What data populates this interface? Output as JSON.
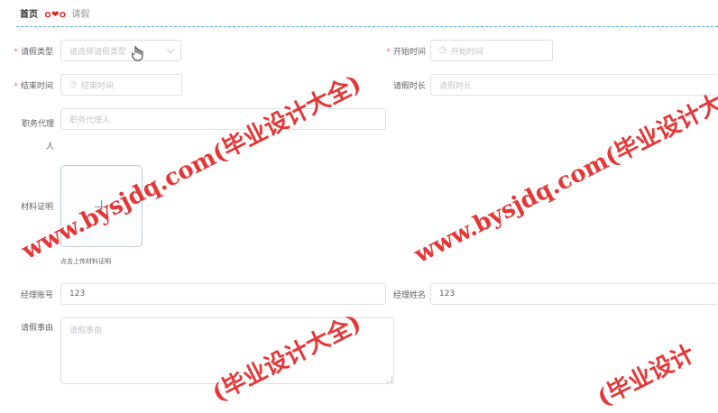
{
  "breadcrumb": {
    "home": "首页",
    "separator_glyphs": "ｏ❤ｏ",
    "current": "请假"
  },
  "form": {
    "leave_type": {
      "label": "请假类型",
      "placeholder": "请选择请假类型",
      "required": true
    },
    "start_time": {
      "label": "开始时间",
      "placeholder": "开始时间",
      "required": true
    },
    "end_time": {
      "label": "结束时间",
      "placeholder": "结束时间",
      "required": true
    },
    "duration": {
      "label": "请假时长",
      "placeholder": "请假时长"
    },
    "deputy": {
      "label": "职务代理人",
      "placeholder": "职务代理人"
    },
    "material": {
      "label": "材料证明",
      "plus": "+",
      "hint": "点击上传材料证明"
    },
    "manager_account": {
      "label": "经理账号",
      "value": "123"
    },
    "manager_name": {
      "label": "经理姓名",
      "value": "123"
    },
    "reason": {
      "label": "请假事由",
      "placeholder": "请假事由"
    }
  },
  "watermark": {
    "site": "www.bysjdq.com(毕业设计大全)",
    "domain": "www.bysjdq.com(毕业设计大全)",
    "suffix": "(毕业设计大全)",
    "prefix": "(毕业设计"
  },
  "colors": {
    "required": "#f56c6c",
    "watermark": "#e01414",
    "dashed_line": "#5fb0e6",
    "border": "#dcdfe6",
    "placeholder": "#c0c4cc"
  }
}
